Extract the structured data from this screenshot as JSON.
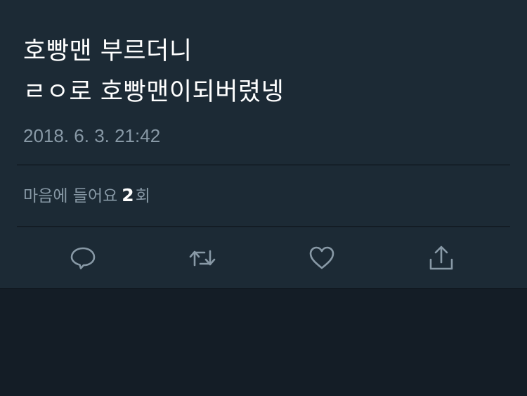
{
  "tweet": {
    "lines": [
      "호빵맨 부르더니",
      "ㄹㅇ로 호빵맨이되버렸넹"
    ],
    "timestamp": "2018. 6. 3. 21:42"
  },
  "likes": {
    "prefix": "마음에 들어요",
    "count": "2",
    "suffix": "회"
  },
  "actions": [
    {
      "icon": "reply-icon"
    },
    {
      "icon": "retweet-icon"
    },
    {
      "icon": "heart-icon"
    },
    {
      "icon": "share-icon"
    }
  ],
  "colors": {
    "background": "#141d26",
    "card": "#1c2a35",
    "text": "#ffffff",
    "muted": "#8899a6"
  }
}
